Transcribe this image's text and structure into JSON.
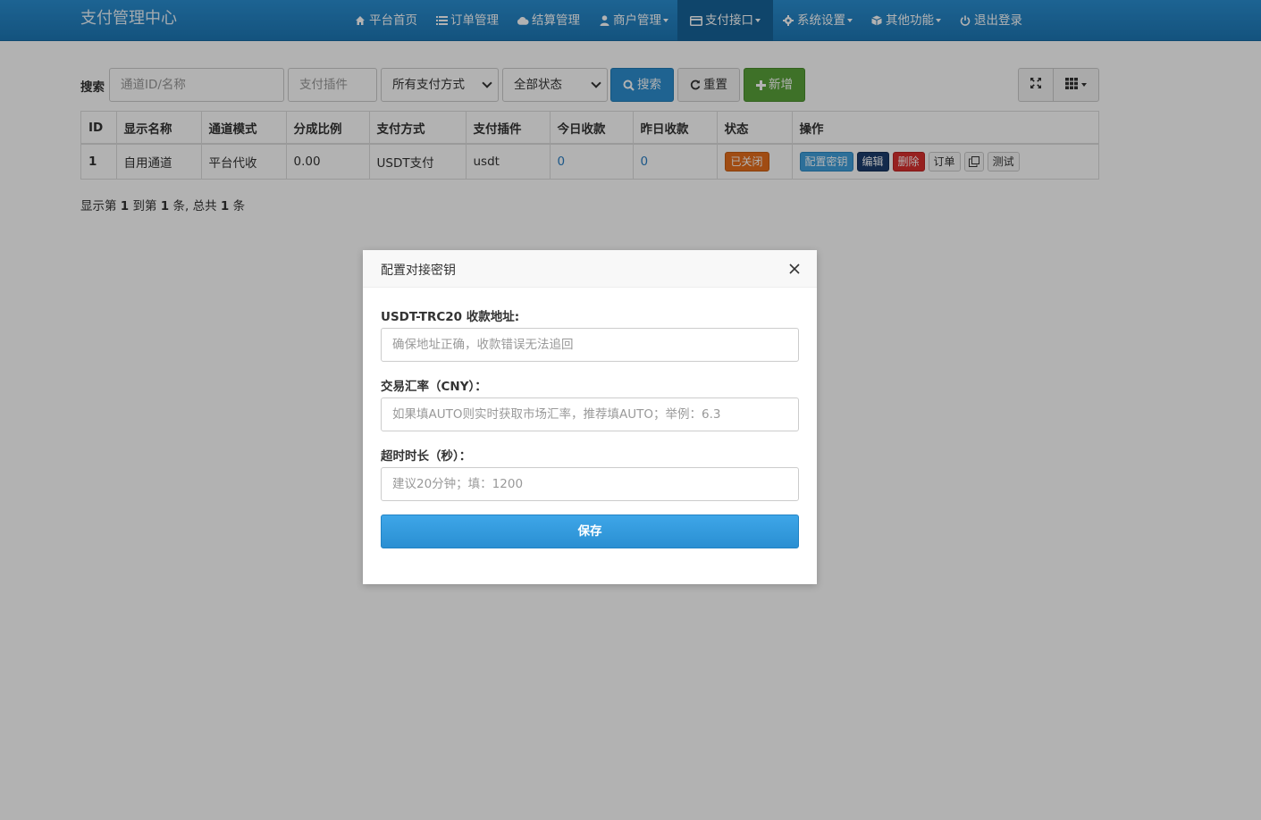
{
  "brand": "支付管理中心",
  "nav": {
    "items": [
      {
        "label": "平台首页",
        "icon": "home-icon"
      },
      {
        "label": "订单管理",
        "icon": "list-icon"
      },
      {
        "label": "结算管理",
        "icon": "cloud-icon"
      },
      {
        "label": "商户管理",
        "icon": "user-icon"
      },
      {
        "label": "支付接口",
        "icon": "credit-card-icon"
      },
      {
        "label": "系统设置",
        "icon": "gear-icon"
      },
      {
        "label": "其他功能",
        "icon": "cube-icon"
      },
      {
        "label": "退出登录",
        "icon": "power-icon"
      }
    ],
    "active": "支付接口"
  },
  "toolbar": {
    "search_label": "搜索",
    "channel_placeholder": "通道ID/名称",
    "plugin_placeholder": "支付插件",
    "method_select": "所有支付方式",
    "status_select": "全部状态",
    "search_button": "搜索",
    "reset_button": "重置",
    "add_button": "新增"
  },
  "table": {
    "headers": [
      "ID",
      "显示名称",
      "通道模式",
      "分成比例",
      "支付方式",
      "支付插件",
      "今日收款",
      "昨日收款",
      "状态",
      "操作"
    ],
    "rows": [
      {
        "id": "1",
        "name": "自用通道",
        "mode": "平台代收",
        "ratio": "0.00",
        "method": "USDT支付",
        "plugin": "usdt",
        "today": "0",
        "yesterday": "0",
        "status": "已关闭",
        "ops": {
          "config_key": "配置密钥",
          "edit": "编辑",
          "delete": "删除",
          "orders": "订单",
          "test": "测试"
        }
      }
    ]
  },
  "summary": {
    "prefix": "显示第",
    "from": "1",
    "to_text": "到第",
    "to": "1",
    "total_text": "条, 总共",
    "total": "1",
    "suffix": "条"
  },
  "modal": {
    "title": "配置对接密钥",
    "fields": [
      {
        "label": "USDT-TRC20 收款地址:",
        "placeholder": "确保地址正确，收款错误无法追回"
      },
      {
        "label": "交易汇率（CNY）：",
        "placeholder": "如果填AUTO则实时获取市场汇率，推荐填AUTO；举例：6.3"
      },
      {
        "label": "超时时长（秒）：",
        "placeholder": "建议20分钟；填：1200"
      }
    ],
    "save_button": "保存"
  },
  "colors": {
    "navbar": "#1d77b5",
    "primary": "#2d8fd0",
    "success": "#5aa33a",
    "danger": "#d8302e",
    "status_closed": "#e66e1c"
  }
}
